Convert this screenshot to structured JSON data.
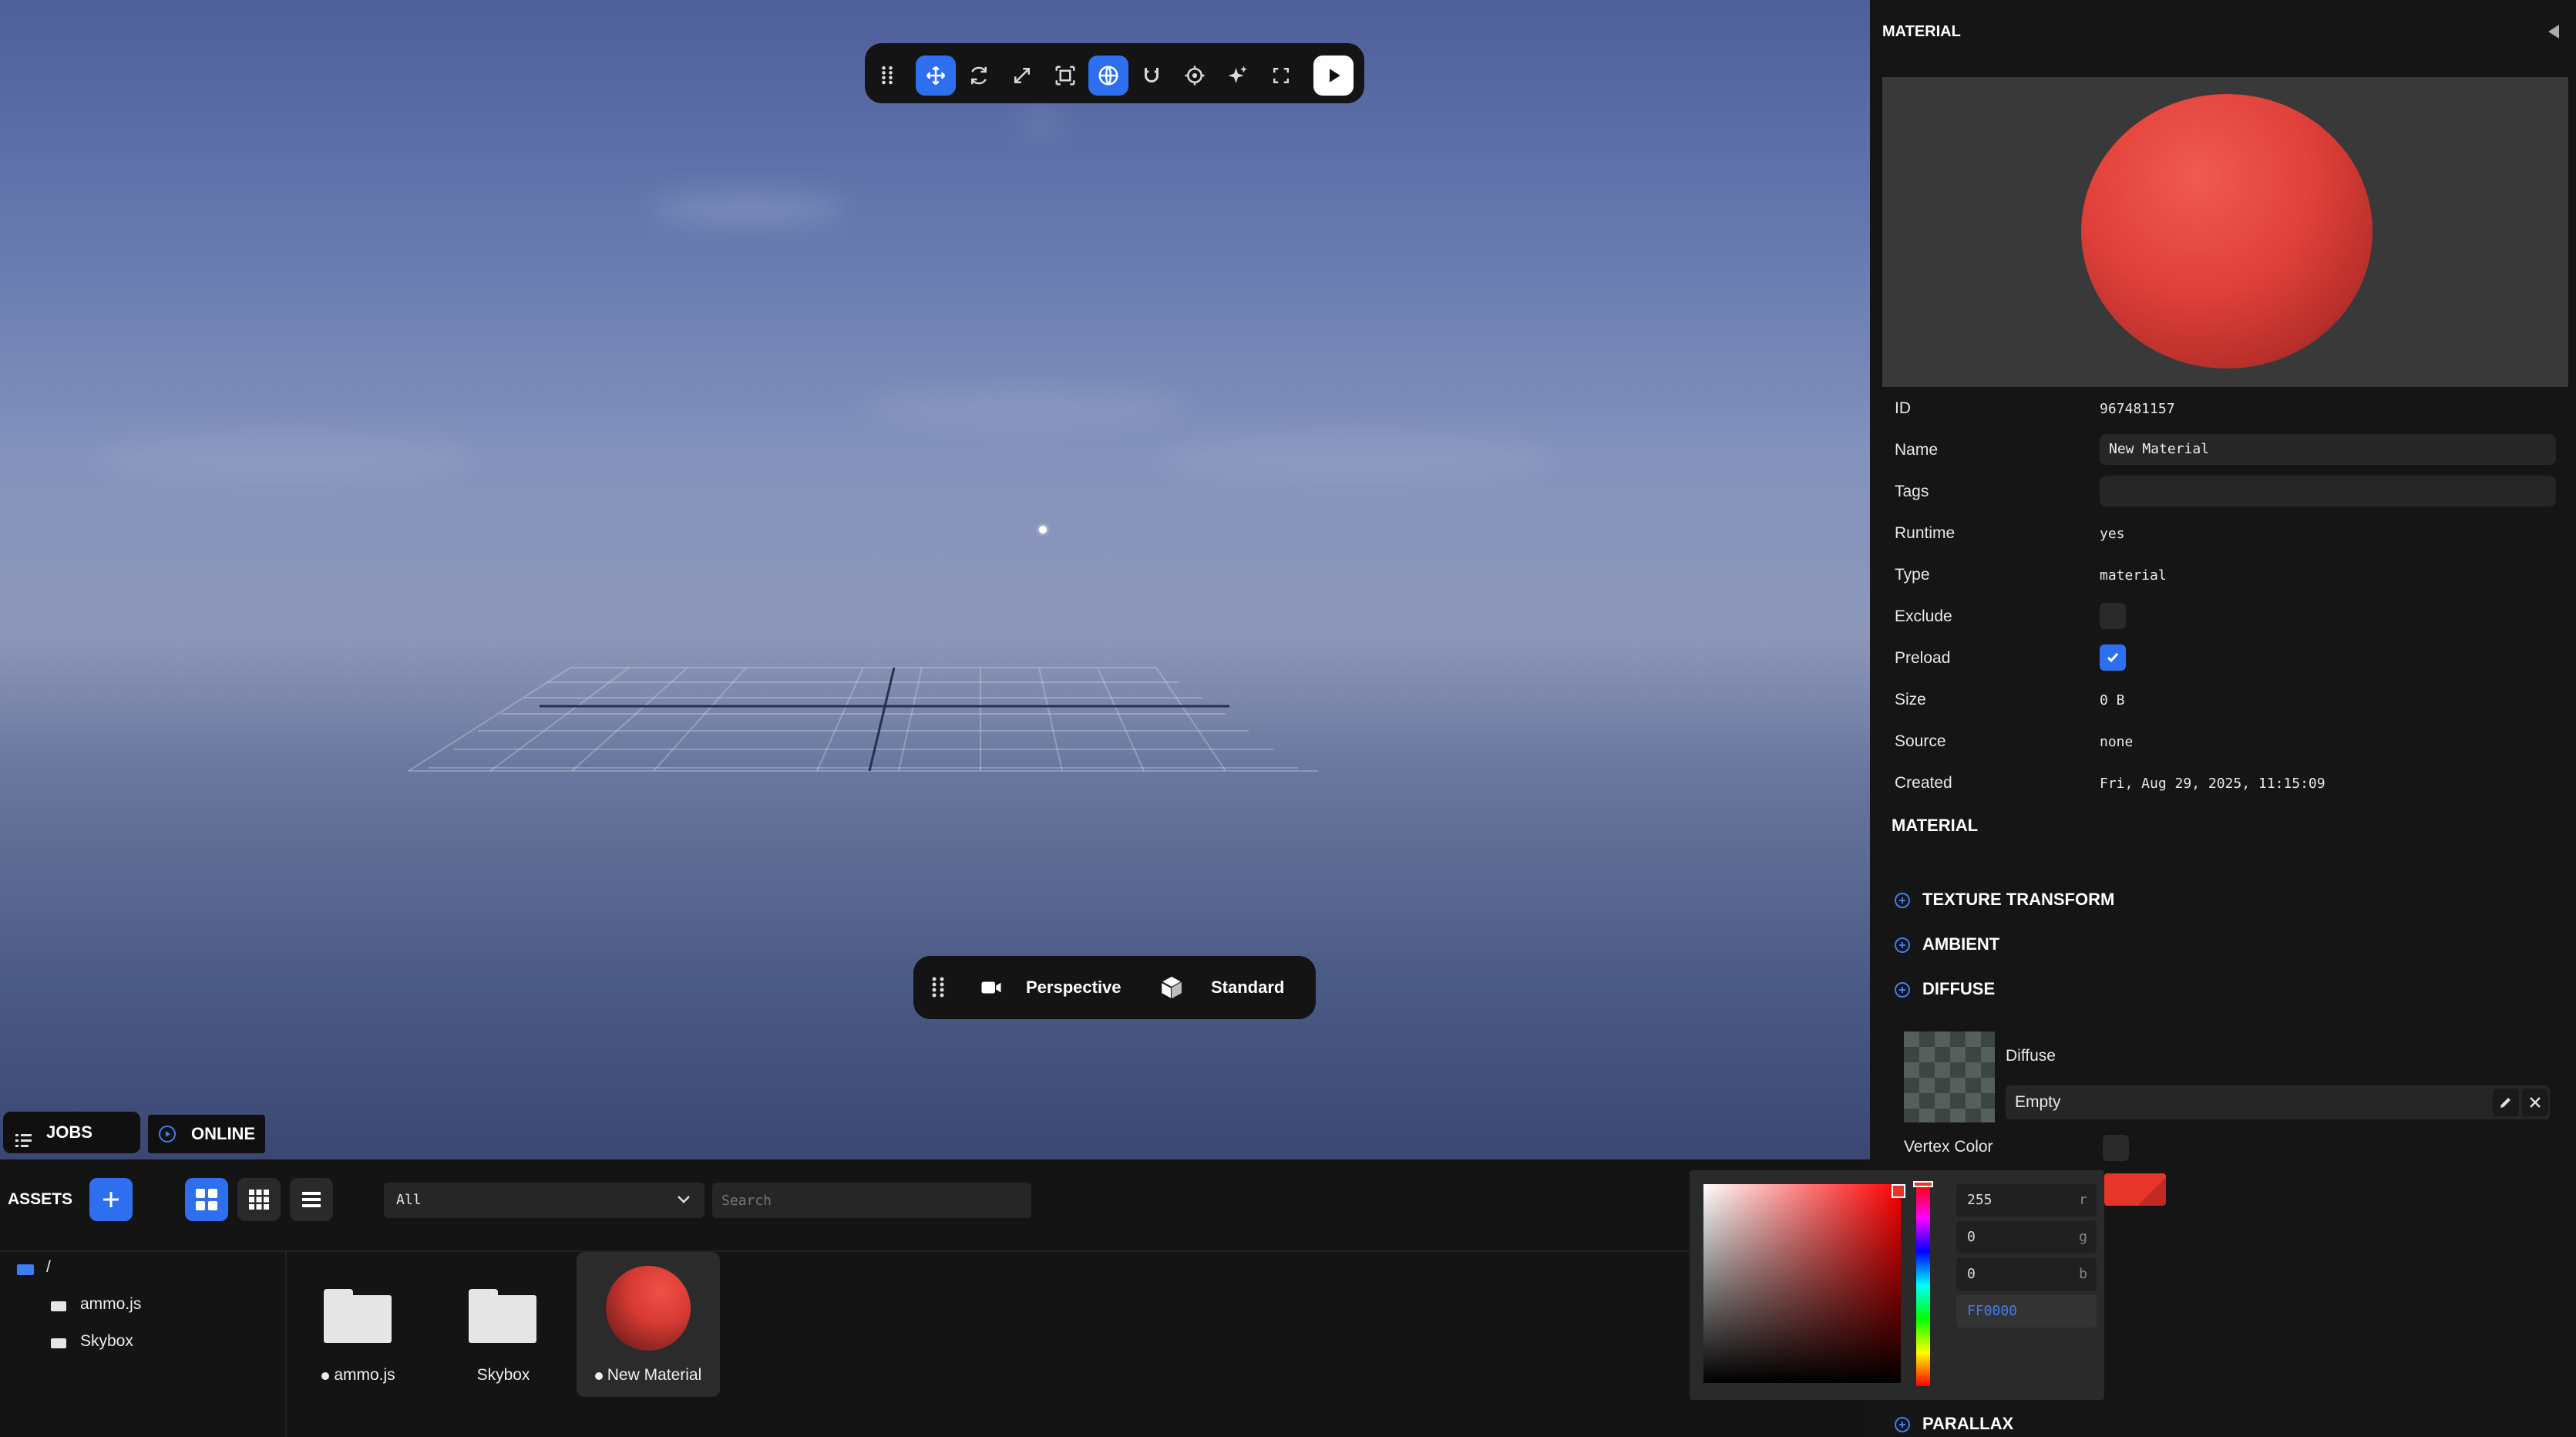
{
  "toolbar": {
    "buttons": [
      {
        "name": "translate",
        "icon": "move-arrows-icon",
        "active": true
      },
      {
        "name": "rotate",
        "icon": "rotate-icon",
        "active": false
      },
      {
        "name": "scale",
        "icon": "scale-arrows-icon",
        "active": false
      },
      {
        "name": "resize",
        "icon": "resize-frame-icon",
        "active": false
      },
      {
        "name": "world-space",
        "icon": "globe-icon",
        "active": true
      },
      {
        "name": "snap",
        "icon": "magnet-icon",
        "active": false
      },
      {
        "name": "focus",
        "icon": "crosshair-icon",
        "active": false
      },
      {
        "name": "lightmap",
        "icon": "sparkle-icon",
        "active": false
      },
      {
        "name": "fullscreen",
        "icon": "fullscreen-corners-icon",
        "active": false
      },
      {
        "name": "launch",
        "icon": "play-icon",
        "active": false
      }
    ]
  },
  "viewport_bar": {
    "camera_label": "Perspective",
    "render_label": "Standard"
  },
  "status": {
    "jobs_label": "JOBS",
    "online_label": "ONLINE"
  },
  "panel": {
    "title": "MATERIAL",
    "collapse_icon": "triangle-left-icon",
    "fields": {
      "id_label": "ID",
      "id_value": "967481157",
      "name_label": "Name",
      "name_value": "New Material",
      "tags_label": "Tags",
      "tags_value": "",
      "runtime_label": "Runtime",
      "runtime_value": "yes",
      "type_label": "Type",
      "type_value": "material",
      "exclude_label": "Exclude",
      "exclude_checked": false,
      "preload_label": "Preload",
      "preload_checked": true,
      "size_label": "Size",
      "size_value": "0 B",
      "source_label": "Source",
      "source_value": "none",
      "created_label": "Created",
      "created_value": "Fri, Aug 29, 2025, 11:15:09"
    },
    "material_heading": "MATERIAL",
    "sections": {
      "texture_transform": "TEXTURE TRANSFORM",
      "ambient": "AMBIENT",
      "diffuse": "DIFFUSE",
      "parallax": "PARALLAX"
    },
    "diffuse": {
      "label": "Diffuse",
      "texture_value": "Empty",
      "vertex_color_label": "Vertex Color",
      "color_hex": "#ff0000"
    }
  },
  "color_picker": {
    "r": "255",
    "g": "0",
    "b": "0",
    "r_label": "r",
    "g_label": "g",
    "b_label": "b",
    "hex": "FF0000"
  },
  "assets": {
    "title": "ASSETS",
    "filter_value": "All",
    "search_placeholder": "Search",
    "tree": [
      {
        "label": "/"
      },
      {
        "label": "ammo.js"
      },
      {
        "label": "Skybox"
      }
    ],
    "items": [
      {
        "label": "ammo.js",
        "kind": "folder",
        "dot": true
      },
      {
        "label": "Skybox",
        "kind": "folder",
        "dot": false
      },
      {
        "label": "New Material",
        "kind": "material",
        "dot": true
      }
    ]
  },
  "colors": {
    "accent": "#2e6ff0",
    "material_red": "#e0403a"
  }
}
